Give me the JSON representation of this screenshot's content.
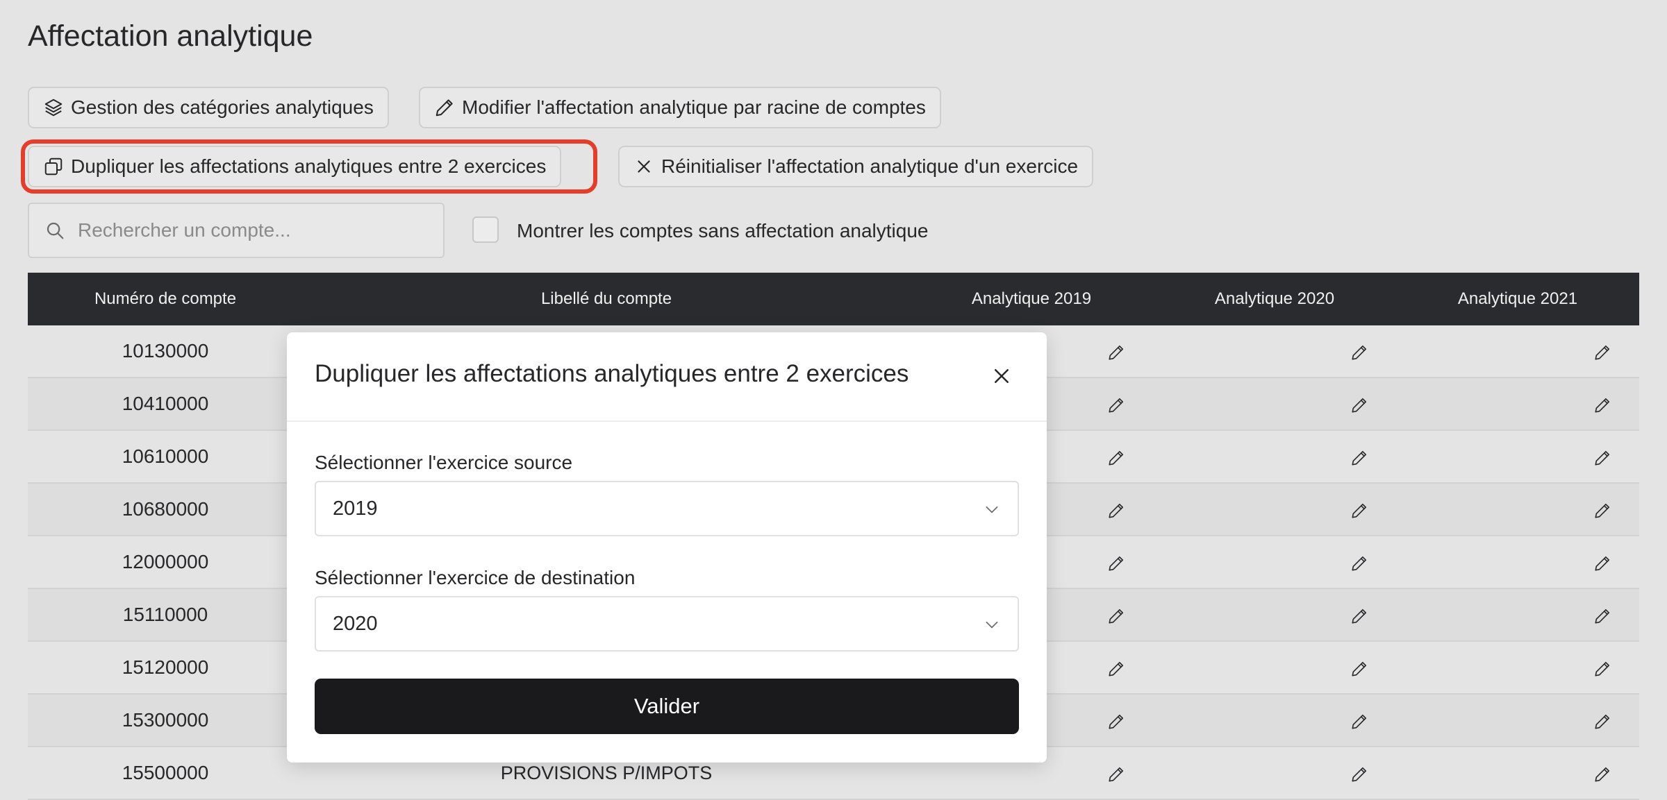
{
  "page": {
    "title": "Affectation analytique"
  },
  "toolbar": {
    "manage_categories": "Gestion des catégories analytiques",
    "modify_by_root": "Modifier l'affectation analytique par racine de comptes",
    "duplicate": "Dupliquer les affectations analytiques entre 2 exercices",
    "reset": "Réinitialiser l'affectation analytique d'un exercice"
  },
  "search": {
    "placeholder": "Rechercher un compte..."
  },
  "filter": {
    "label": "Montrer les comptes sans affectation analytique",
    "checked": false
  },
  "table": {
    "headers": [
      "Numéro de compte",
      "Libellé du compte",
      "Analytique 2019",
      "Analytique 2020",
      "Analytique 2021"
    ],
    "rows": [
      {
        "account": "10130000",
        "label": ""
      },
      {
        "account": "10410000",
        "label": ""
      },
      {
        "account": "10610000",
        "label": ""
      },
      {
        "account": "10680000",
        "label": ""
      },
      {
        "account": "12000000",
        "label": ""
      },
      {
        "account": "15110000",
        "label": ""
      },
      {
        "account": "15120000",
        "label": ""
      },
      {
        "account": "15300000",
        "label": ""
      },
      {
        "account": "15500000",
        "label": "PROVISIONS P/IMPOTS"
      }
    ]
  },
  "modal": {
    "title": "Dupliquer les affectations analytiques entre 2 exercices",
    "source_label": "Sélectionner l'exercice source",
    "source_value": "2019",
    "destination_label": "Sélectionner l'exercice de destination",
    "destination_value": "2020",
    "submit_label": "Valider"
  },
  "colors": {
    "highlight": "#e53d2a",
    "table_header": "#2a2b2f",
    "primary_button": "#1a1a1c"
  }
}
